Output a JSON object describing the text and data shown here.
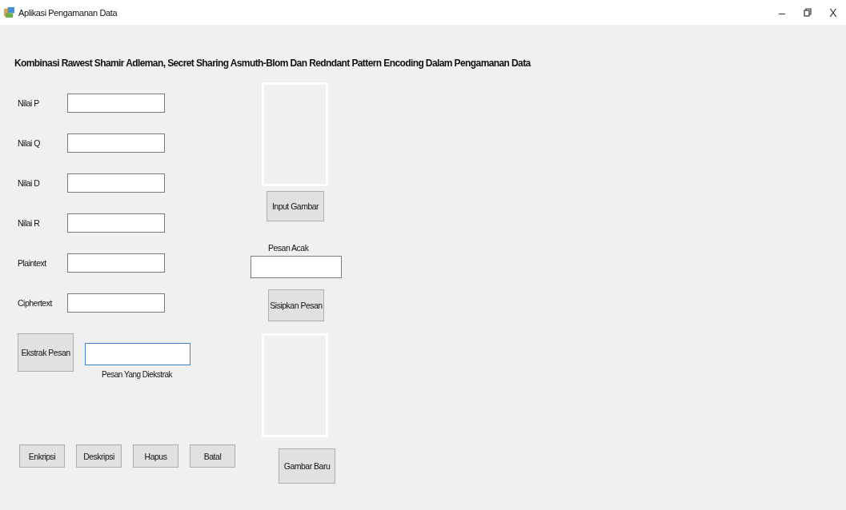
{
  "window": {
    "title": "Aplikasi Pengamanan Data",
    "controls": [
      "–",
      "X"
    ]
  },
  "heading": "Kombinasi Rawest Shamir Adleman, Secret Sharing Asmuth-Blom Dan Redndant Pattern Encoding Dalam Pengamanan Data",
  "fields": [
    {
      "label": "Nilai P"
    },
    {
      "label": "Nilai Q"
    },
    {
      "label": "Nilai D"
    },
    {
      "label": "Nilai R"
    },
    {
      "label": "Plaintext"
    },
    {
      "label": "Ciphertext"
    }
  ],
  "extract": {
    "button": "Ekstrak Pesan",
    "caption": "Pesan Yang Diekstrak"
  },
  "bottom_buttons": [
    "Enkripsi",
    "Deskripsi",
    "Hapus",
    "Batal"
  ],
  "middle": {
    "input_button": "Input Gambar",
    "random_label": "Pesan Acak",
    "insert_button": "Sisipkan Pesan",
    "new_button": "Gambar Baru"
  }
}
